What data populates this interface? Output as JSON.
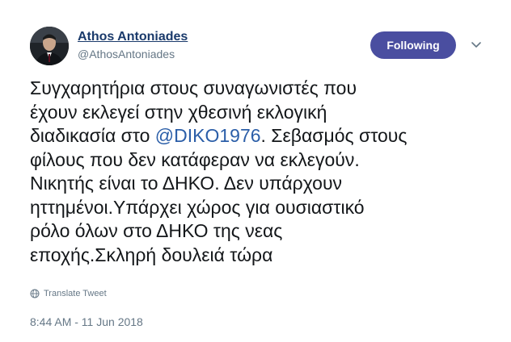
{
  "author": {
    "display_name": "Athos Antoniades",
    "handle": "@AthosAntoniades",
    "avatar_icon": "profile-photo"
  },
  "follow_button": {
    "label": "Following",
    "color": "#4a4ea0"
  },
  "menu": {
    "icon": "chevron-down-icon"
  },
  "tweet": {
    "text_before": "Συγχαρητήρια στους συναγωνιστές που\nέχουν εκλεγεί στην χθεσινή εκλογική\nδιαδικασία στο ",
    "mention": "@DIKO1976",
    "text_after": ". Σεβασμός στους\nφίλους που δεν κατάφεραν να εκλεγούν.\nΝικητής είναι το ΔΗΚΟ. Δεν υπάρχουν\nηττημένοι.Υπάρχει χώρος για ουσιαστικό\nρόλο όλων στο ΔΗΚΟ της νεας\nεποχής.Σκληρή δουλειά τώρα"
  },
  "translate": {
    "label": "Translate Tweet",
    "icon": "globe-icon"
  },
  "timestamp": "8:44 AM - 11 Jun 2018",
  "colors": {
    "link": "#2b5ea8",
    "name": "#1a3a6b",
    "secondary_text": "#657786"
  }
}
